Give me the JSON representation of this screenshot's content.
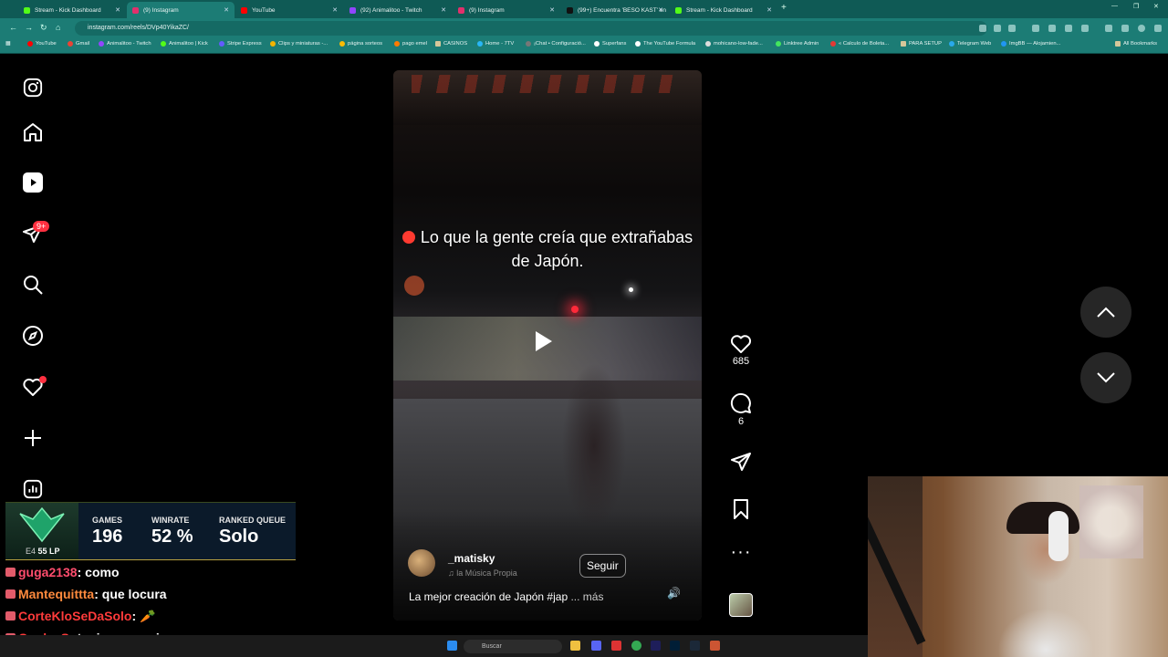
{
  "tabs": [
    {
      "title": "Stream - Kick Dashboard",
      "color": "#53fc18"
    },
    {
      "title": "(9) Instagram",
      "color": "#e1306c"
    },
    {
      "title": "YouTube",
      "color": "#ff0000"
    },
    {
      "title": "(92) Animalitoo - Twitch",
      "color": "#9146ff"
    },
    {
      "title": "(9) Instagram",
      "color": "#e1306c"
    },
    {
      "title": "(99+) Encuentra 'BESO KAST' en",
      "color": "#111111"
    },
    {
      "title": "Stream - Kick Dashboard",
      "color": "#53fc18"
    }
  ],
  "url": "instagram.com/reels/DVp40YikaZC/",
  "bookmarks": [
    "YouTube",
    "Gmail",
    "Animalitoo - Twitch",
    "Animalitoo | Kick",
    "Stripe Express",
    "Clips y miniaturas -...",
    "página sorteos",
    "pago emel",
    "CASINOS",
    "Home - 7TV",
    "¡Chat • Configuració...",
    "Superfans",
    "The YouTube Formula",
    "mohicano-low-fade...",
    "Linktree Admin",
    "« Calculo de Boleta...",
    "PARA SETUP",
    "Telegram Web",
    "ImgBB — Alojamien...",
    "All Bookmarks"
  ],
  "sidebar": {
    "notifications_badge": "9+"
  },
  "reel": {
    "caption": "Lo que la gente creía que extrañabas de Japón.",
    "username": "_matisky",
    "music": "♫  la Música Propia",
    "follow_label": "Seguir",
    "description": "La mejor creación de Japón #jap",
    "more_label": "... más"
  },
  "actions": {
    "likes": "685",
    "comments": "6"
  },
  "stream_overlay": {
    "rank_lp": "55 LP",
    "rank_tier": "E4",
    "stats": [
      {
        "label": "GAMES",
        "value": "196"
      },
      {
        "label": "WINRATE",
        "value": "52 %"
      },
      {
        "label": "RANKED QUEUE",
        "value": "Solo"
      }
    ],
    "chat": [
      {
        "user": "guga2138",
        "message": "como",
        "color": "#ff4d6d"
      },
      {
        "user": "Mantequittta",
        "message": "que locura",
        "color": "#ff8a3d"
      },
      {
        "user": "CorteKloSeDaSolo",
        "message": "🥕",
        "color": "#ff3b3b"
      },
      {
        "user": "CoulesS",
        "message": "teni que gemir",
        "color": "#ff3b3b"
      }
    ]
  },
  "taskbar": {
    "search_label": "Buscar"
  }
}
